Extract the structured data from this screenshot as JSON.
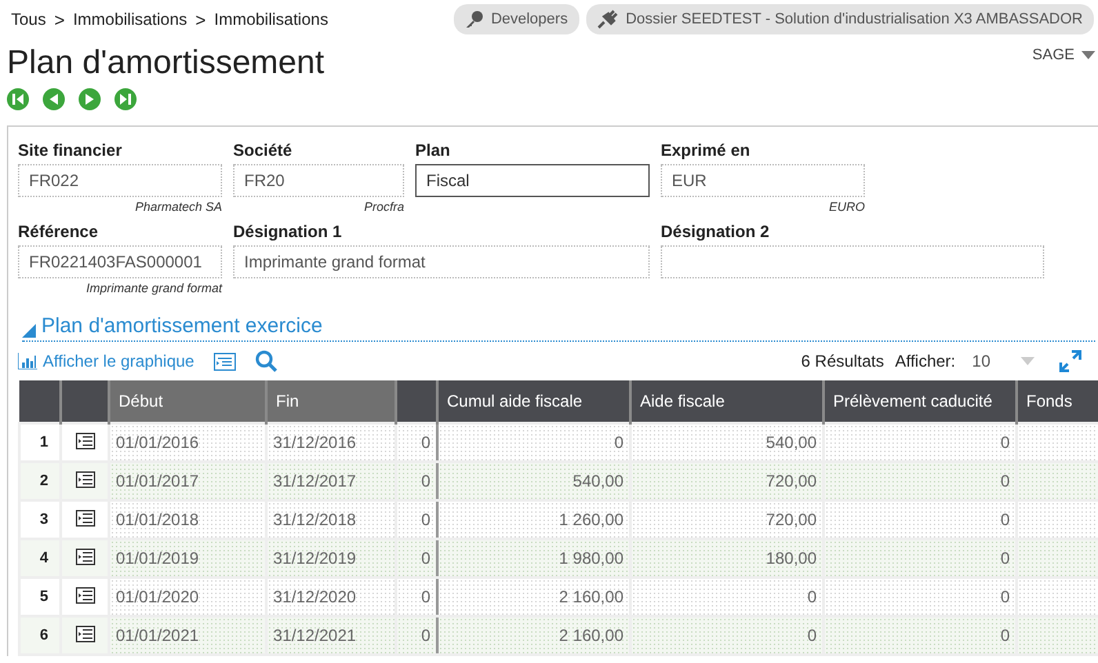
{
  "breadcrumb": {
    "items": [
      "Tous",
      "Immobilisations",
      "Immobilisations"
    ],
    "separator": ">"
  },
  "header_buttons": [
    {
      "label": "Developers",
      "kind": "key"
    },
    {
      "label": "Dossier SEEDTEST - Solution d'industrialisation X3 AMBASSADOR",
      "kind": "plug"
    }
  ],
  "title": "Plan d'amortissement",
  "user_menu": "SAGE",
  "field_rows": [
    [
      {
        "label": "Site financier",
        "value": "FR022",
        "caption": "Pharmatech SA",
        "kind": "readonly"
      },
      {
        "label": "Société",
        "value": "FR20",
        "caption": "Procfra",
        "kind": "readonly"
      },
      {
        "label": "Plan",
        "value": "Fiscal",
        "kind": "input"
      },
      {
        "label": "Exprimé en",
        "value": "EUR",
        "caption": "EURO",
        "kind": "readonly"
      }
    ],
    [
      {
        "label": "Référence",
        "value": "FR0221403FAS000001",
        "caption": "Imprimante grand format",
        "kind": "readonly"
      },
      {
        "label": "Désignation 1",
        "value": "Imprimante grand format",
        "kind": "readonly"
      },
      {
        "label": "Désignation 2",
        "kind": "readonly"
      }
    ]
  ],
  "section": {
    "title": "Plan d'amortissement exercice",
    "expanded": true
  },
  "toolbar": {
    "chart_link": "Afficher le graphique",
    "results": "6 Résultats",
    "show_label": "Afficher:",
    "page_size": "10"
  },
  "table": {
    "columns": [
      {
        "kind": "index"
      },
      {
        "kind": "icon"
      },
      {
        "label": "Début",
        "kind": "key"
      },
      {
        "label": "Fin",
        "kind": "key"
      },
      {
        "kind": "blank"
      },
      {
        "label": "Cumul aide fiscale",
        "kind": "normal"
      },
      {
        "label": "Aide fiscale",
        "kind": "normal"
      },
      {
        "label": "Prélèvement caducité",
        "kind": "normal"
      },
      {
        "label": "Fonds",
        "kind": "normal"
      }
    ],
    "rows": [
      {
        "cells": [
          "1",
          "",
          "01/01/2016",
          "31/12/2016",
          "0",
          "0",
          "540,00",
          "0"
        ]
      },
      {
        "cells": [
          "2",
          "",
          "01/01/2017",
          "31/12/2017",
          "0",
          "540,00",
          "720,00",
          "0"
        ]
      },
      {
        "cells": [
          "3",
          "",
          "01/01/2018",
          "31/12/2018",
          "0",
          "1 260,00",
          "720,00",
          "0"
        ]
      },
      {
        "cells": [
          "4",
          "",
          "01/01/2019",
          "31/12/2019",
          "0",
          "1 980,00",
          "180,00",
          "0"
        ]
      },
      {
        "cells": [
          "5",
          "",
          "01/01/2020",
          "31/12/2020",
          "0",
          "2 160,00",
          "0",
          "0"
        ]
      },
      {
        "cells": [
          "6",
          "",
          "01/01/2021",
          "31/12/2021",
          "0",
          "2 160,00",
          "0",
          "0"
        ]
      }
    ]
  }
}
